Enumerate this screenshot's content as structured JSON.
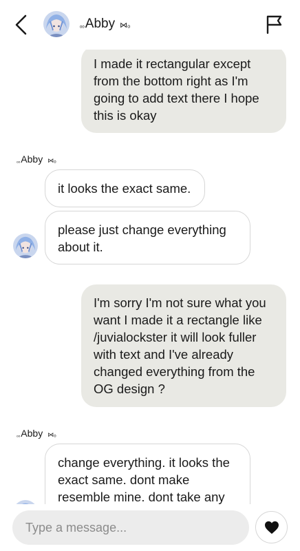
{
  "header": {
    "name_prefix": "ₒₒ",
    "name": "Abby",
    "name_suffix": "⋈ₒ",
    "back_icon": "chevron-left-icon",
    "report_icon": "flag-icon"
  },
  "messages": [
    {
      "direction": "outgoing",
      "lines": [
        "I made it rectangular except",
        "from the bottom right as I'm",
        "going to add text there I hope",
        "this is okay"
      ]
    },
    {
      "sender_label": {
        "prefix": "ₒₒ",
        "name": "Abby",
        "suffix": "⋈ₒ"
      }
    },
    {
      "direction": "incoming",
      "lines": [
        "it looks the exact same."
      ]
    },
    {
      "direction": "incoming",
      "lines": [
        "please just change everything",
        "about it."
      ]
    },
    {
      "direction": "outgoing",
      "lines": [
        "I'm sorry I'm not sure what you",
        "want I made it a rectangle like",
        "/juvialockster it will look fuller",
        "with text and I've already",
        "changed everything from the",
        "OG design ?"
      ]
    },
    {
      "sender_label": {
        "prefix": "ₒₒ",
        "name": "Abby",
        "suffix": "⋈ₒ"
      }
    },
    {
      "direction": "incoming",
      "lines": [
        "change everything. it looks the",
        "exact same. dont make",
        "resemble mine. dont take any"
      ]
    }
  ],
  "composer": {
    "placeholder": "Type a message...",
    "like_icon": "heart-icon"
  },
  "colors": {
    "outgoing_bubble": "#e9e9e4",
    "incoming_border": "#d6d6d6",
    "input_bg": "#ececec"
  }
}
